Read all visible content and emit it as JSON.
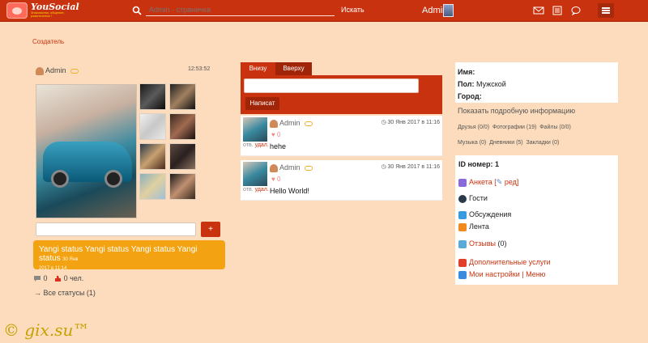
{
  "header": {
    "brand": "YouSocial",
    "tagline": "Знакомства, общение, развлечения !",
    "search_placeholder": "Admin - страничка",
    "search_button": "Искать",
    "user": "Admin"
  },
  "page": {
    "creator_label": "Создатель"
  },
  "profile": {
    "name": "Admin",
    "time": "12:53:52",
    "status_add": "+",
    "status_text": "Yangi status Yangi status Yangi status Yangi status",
    "status_date_1": "30 Янв",
    "status_date_2": "2017 в 11:14",
    "comments": "0",
    "likes": "0 чел.",
    "all_statuses": "→ Все статусы (1)"
  },
  "wall": {
    "tab_down": "Внизу",
    "tab_up": "Вверху",
    "submit": "Написат",
    "posts": [
      {
        "author": "Admin",
        "date": "30 Янв 2017 в 11:16",
        "likes": "0",
        "reply": "отв.",
        "delete": "удал.",
        "text": "hehe"
      },
      {
        "author": "Admin",
        "date": "30 Янв 2017 в 11:16",
        "likes": "0",
        "reply": "отв.",
        "delete": "удал.",
        "text": "Hello World!"
      }
    ]
  },
  "info": {
    "name_label": "Имя:",
    "sex_label": "Пол:",
    "sex_value": "Мужской",
    "city_label": "Город:",
    "more": "Показать подробную информацию",
    "friends": "Друзья (0/0)",
    "photos": "Фотографии (19)",
    "files": "Файлы (0/0)",
    "music": "Музыка (0)",
    "diaries": "Дневники (5)",
    "bookmarks": "Закладки (0)"
  },
  "menu": {
    "id": "ID номер: 1",
    "anketa": "Анкета",
    "edit": "ред",
    "guests": "Гости",
    "discussions": "Обсуждения",
    "feed": "Лента",
    "reviews": "Отзывы",
    "reviews_count": "(0)",
    "services": "Дополнительные услуги",
    "settings": "Мои настройки",
    "sep": "|",
    "menu_label": "Меню"
  },
  "watermark": "© gix.su™"
}
